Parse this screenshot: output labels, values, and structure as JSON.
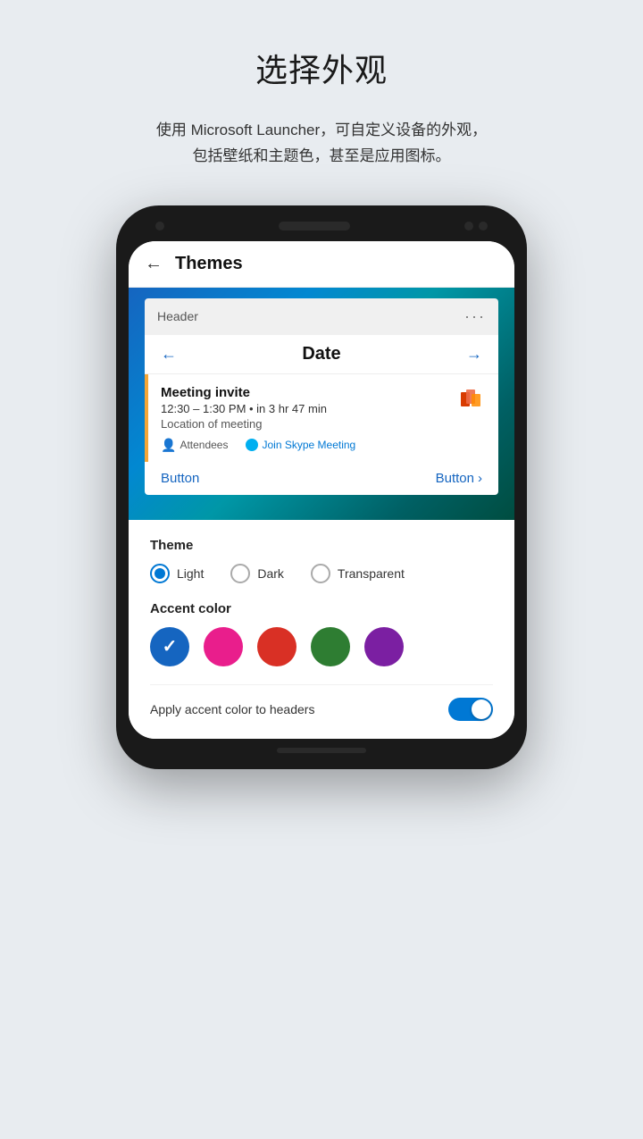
{
  "page": {
    "title": "选择外观",
    "subtitle": "使用 Microsoft Launcher，可自定义设备的外观，\n包括壁纸和主题色，甚至是应用图标。"
  },
  "phone": {
    "themes_screen": {
      "header": {
        "back_label": "←",
        "title": "Themes"
      },
      "calendar_card": {
        "header_text": "Header",
        "dots": "···",
        "date_label": "Date",
        "left_arrow": "←",
        "right_arrow": "→",
        "meeting": {
          "title": "Meeting invite",
          "time": "12:30 – 1:30 PM • in 3 hr 47 min",
          "location": "Location of meeting",
          "attendees_label": "Attendees",
          "skype_label": "Join Skype Meeting"
        },
        "button_left": "Button",
        "button_right": "Button",
        "button_right_arrow": "›"
      },
      "theme_section": {
        "title": "Theme",
        "options": [
          {
            "label": "Light",
            "selected": true
          },
          {
            "label": "Dark",
            "selected": false
          },
          {
            "label": "Transparent",
            "selected": false
          }
        ]
      },
      "accent_section": {
        "title": "Accent color",
        "colors": [
          {
            "name": "blue",
            "hex": "#1565c0",
            "selected": true
          },
          {
            "name": "pink",
            "hex": "#e91e8c",
            "selected": false
          },
          {
            "name": "orange-red",
            "hex": "#d93025",
            "selected": false
          },
          {
            "name": "green",
            "hex": "#2e7d32",
            "selected": false
          },
          {
            "name": "purple",
            "hex": "#7b1fa2",
            "selected": false
          }
        ]
      },
      "apply_accent": {
        "label": "Apply accent color to headers",
        "toggle_on": true
      }
    }
  }
}
